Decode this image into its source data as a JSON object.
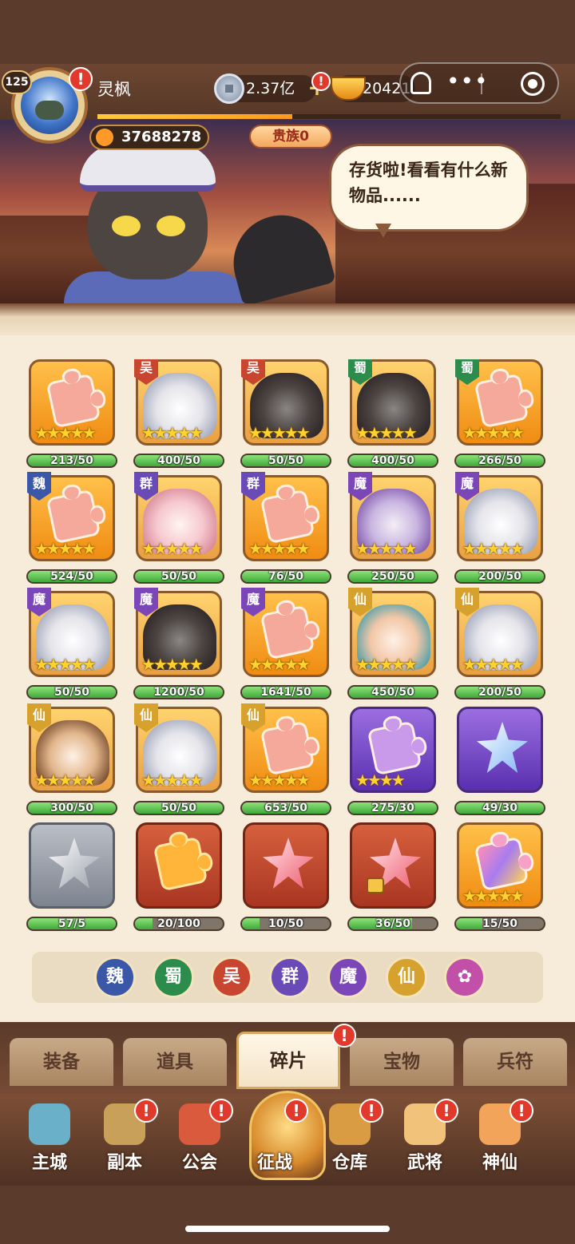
{
  "player": {
    "level": "125",
    "name": "灵枫",
    "gold": "37688278",
    "noble": "贵族0"
  },
  "resources": {
    "silver": "2.37亿",
    "ingot": "20421"
  },
  "banner": {
    "speech": "存货啦!看看有什么新物品......"
  },
  "xp_progress": 0.42,
  "grid": [
    {
      "faction": "",
      "stars": "★★★★★",
      "count": "213/50",
      "kind": "puzzle",
      "fill": 1
    },
    {
      "faction": "吴",
      "stars": "★★★★★",
      "count": "400/50",
      "kind": "portrait",
      "fill": 1
    },
    {
      "faction": "吴",
      "stars": "★★★★★",
      "count": "50/50",
      "kind": "portrait",
      "fill": 1
    },
    {
      "faction": "蜀",
      "stars": "★★★★★",
      "count": "400/50",
      "kind": "portrait",
      "fill": 1
    },
    {
      "faction": "蜀",
      "stars": "★★★★★",
      "count": "266/50",
      "kind": "puzzle",
      "fill": 1
    },
    {
      "faction": "魏",
      "stars": "★★★★★",
      "count": "524/50",
      "kind": "puzzle",
      "fill": 1
    },
    {
      "faction": "群",
      "stars": "★★★★★",
      "count": "50/50",
      "kind": "portrait",
      "fill": 1
    },
    {
      "faction": "群",
      "stars": "★★★★★",
      "count": "76/50",
      "kind": "puzzle",
      "fill": 1
    },
    {
      "faction": "魔",
      "stars": "★★★★★",
      "count": "250/50",
      "kind": "portrait",
      "fill": 1
    },
    {
      "faction": "魔",
      "stars": "★★★★★",
      "count": "200/50",
      "kind": "portrait",
      "fill": 1
    },
    {
      "faction": "魔",
      "stars": "★★★★★",
      "count": "50/50",
      "kind": "portrait",
      "fill": 1
    },
    {
      "faction": "魔",
      "stars": "★★★★★",
      "count": "1200/50",
      "kind": "portrait",
      "fill": 1
    },
    {
      "faction": "魔",
      "stars": "★★★★★",
      "count": "1641/50",
      "kind": "puzzle",
      "fill": 1
    },
    {
      "faction": "仙",
      "stars": "★★★★★",
      "count": "450/50",
      "kind": "portrait",
      "fill": 1
    },
    {
      "faction": "仙",
      "stars": "★★★★★",
      "count": "200/50",
      "kind": "portrait",
      "fill": 1
    },
    {
      "faction": "仙",
      "stars": "★★★★★",
      "count": "300/50",
      "kind": "portrait",
      "fill": 1
    },
    {
      "faction": "仙",
      "stars": "★★★★★",
      "count": "50/50",
      "kind": "portrait",
      "fill": 1
    },
    {
      "faction": "仙",
      "stars": "★★★★★",
      "count": "653/50",
      "kind": "puzzle",
      "fill": 1
    },
    {
      "faction": "",
      "stars": "★★★★",
      "count": "275/30",
      "kind": "puzzle-violet",
      "fill": 1
    },
    {
      "faction": "",
      "stars": "",
      "count": "49/30",
      "kind": "gem-blue",
      "fill": 1
    },
    {
      "faction": "",
      "stars": "",
      "count": "57/5",
      "kind": "gem-silver",
      "fill": 1
    },
    {
      "faction": "",
      "stars": "",
      "count": "20/100",
      "kind": "puzzle-fire",
      "fill": 0.2
    },
    {
      "faction": "",
      "stars": "",
      "count": "10/50",
      "kind": "gem-pink",
      "fill": 0.2
    },
    {
      "faction": "",
      "stars": "",
      "count": "36/50",
      "kind": "gem-pink-lock",
      "fill": 0.72
    },
    {
      "faction": "",
      "stars": "★★★★★",
      "count": "15/50",
      "kind": "puzzle-rainbow",
      "fill": 0.3
    }
  ],
  "filters": [
    "魏",
    "蜀",
    "吴",
    "群",
    "魔",
    "仙",
    ""
  ],
  "tabs": [
    "装备",
    "道具",
    "碎片",
    "宝物",
    "兵符"
  ],
  "active_tab": "碎片",
  "nav": [
    "主城",
    "副本",
    "公会",
    "征战",
    "仓库",
    "武将",
    "神仙"
  ],
  "colors": {
    "wei": "#3b57a8",
    "shu": "#2c8c4c",
    "wu": "#c8452f",
    "qun": "#6a4ab6",
    "mo": "#7b46b8",
    "xian": "#d6a12c"
  }
}
